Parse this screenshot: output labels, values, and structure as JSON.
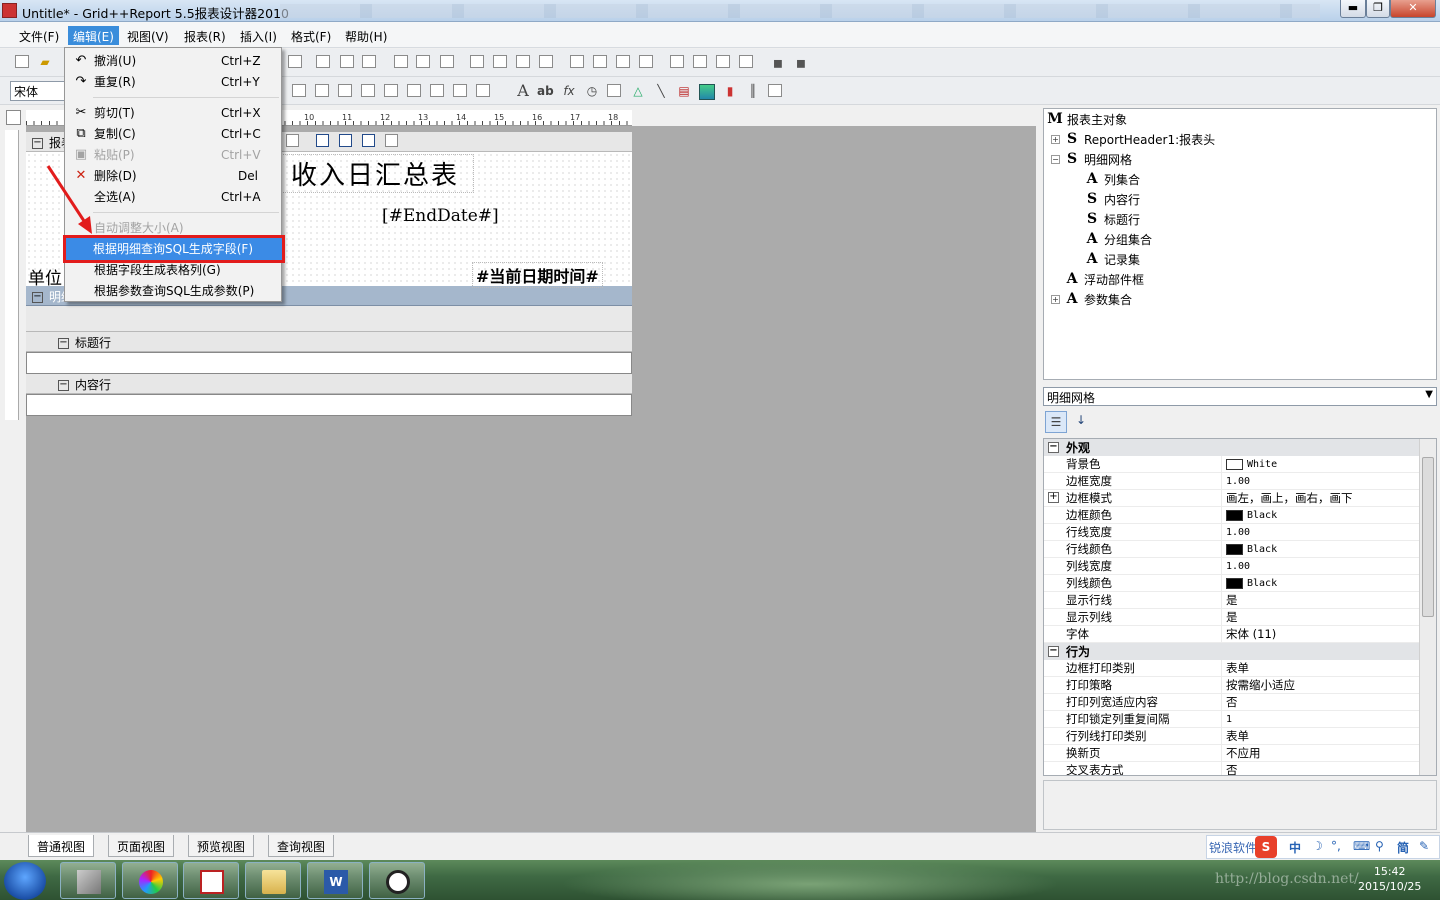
{
  "window": {
    "title": "Untitle* - Grid++Report 5.5报表设计器2010",
    "min": "▬",
    "max": "❐",
    "close": "✕"
  },
  "menubar": [
    {
      "label": "文件(F)"
    },
    {
      "label": "编辑(E)"
    },
    {
      "label": "视图(V)"
    },
    {
      "label": "报表(R)"
    },
    {
      "label": "插入(I)"
    },
    {
      "label": "格式(F)"
    },
    {
      "label": "帮助(H)"
    }
  ],
  "toolbar": {
    "font_name": "宋体"
  },
  "edit_menu": {
    "undo": {
      "label": "撤消(U)",
      "shortcut": "Ctrl+Z"
    },
    "redo": {
      "label": "重复(R)",
      "shortcut": "Ctrl+Y"
    },
    "cut": {
      "label": "剪切(T)",
      "shortcut": "Ctrl+X"
    },
    "copy": {
      "label": "复制(C)",
      "shortcut": "Ctrl+C"
    },
    "paste": {
      "label": "粘贴(P)",
      "shortcut": "Ctrl+V"
    },
    "delete": {
      "label": "删除(D)",
      "shortcut": "Del"
    },
    "select_all": {
      "label": "全选(A)",
      "shortcut": "Ctrl+A"
    },
    "auto_size": {
      "label": "自动调整大小(A)"
    },
    "gen_fields": {
      "label": "根据明细查询SQL生成字段(F)"
    },
    "gen_columns": {
      "label": "根据字段生成表格列(G)"
    },
    "gen_params": {
      "label": "根据参数查询SQL生成参数(P)"
    }
  },
  "ruler": {
    "ticks": [
      "10",
      "11",
      "12",
      "13",
      "14",
      "15",
      "16",
      "17",
      "18"
    ]
  },
  "design": {
    "header_band": "报表",
    "title_text": "收入日汇总表",
    "end_date": "[#EndDate#]",
    "unit_label": "单位",
    "datetime_label": "#当前日期时间#",
    "grid_band": "明细",
    "title_row_band": "标题行",
    "content_row_band": "内容行"
  },
  "tree": [
    {
      "letter": "M",
      "label": "报表主对象",
      "expand": ""
    },
    {
      "letter": "S",
      "label": "ReportHeader1:报表头",
      "expand": "+"
    },
    {
      "letter": "S",
      "label": "明细网格",
      "expand": "−"
    },
    {
      "letter": "A",
      "label": "列集合",
      "expand": ""
    },
    {
      "letter": "S",
      "label": "内容行",
      "expand": ""
    },
    {
      "letter": "S",
      "label": "标题行",
      "expand": ""
    },
    {
      "letter": "A",
      "label": "分组集合",
      "expand": ""
    },
    {
      "letter": "A",
      "label": "记录集",
      "expand": ""
    },
    {
      "letter": "A",
      "label": "浮动部件框",
      "expand": ""
    },
    {
      "letter": "A",
      "label": "参数集合",
      "expand": "+"
    }
  ],
  "object_select": "明细网格",
  "props": {
    "cat_appearance": "外观",
    "cat_behavior": "行为",
    "appearance": [
      {
        "name": "背景色",
        "value": "White",
        "color": "#ffffff"
      },
      {
        "name": "边框宽度",
        "value": "1.00"
      },
      {
        "name": "边框模式",
        "value": "画左，画上，画右，画下",
        "expand": "+"
      },
      {
        "name": "边框颜色",
        "value": "Black",
        "color": "#000000"
      },
      {
        "name": "行线宽度",
        "value": "1.00"
      },
      {
        "name": "行线颜色",
        "value": "Black",
        "color": "#000000"
      },
      {
        "name": "列线宽度",
        "value": "1.00"
      },
      {
        "name": "列线颜色",
        "value": "Black",
        "color": "#000000"
      },
      {
        "name": "显示行线",
        "value": "是"
      },
      {
        "name": "显示列线",
        "value": "是"
      },
      {
        "name": "字体",
        "value": "宋体 (11)"
      }
    ],
    "behavior": [
      {
        "name": "边框打印类别",
        "value": "表单"
      },
      {
        "name": "打印策略",
        "value": "按需缩小适应"
      },
      {
        "name": "打印列宽适应内容",
        "value": "否"
      },
      {
        "name": "打印锁定列重复间隔",
        "value": "1"
      },
      {
        "name": "行列线打印类别",
        "value": "表单"
      },
      {
        "name": "换新页",
        "value": "不应用"
      },
      {
        "name": "交叉表方式",
        "value": "否"
      }
    ]
  },
  "tabs": [
    "普通视图",
    "页面视图",
    "预览视图",
    "查询视图"
  ],
  "ime": {
    "brand": "锐浪软件",
    "zh": "中",
    "simp": "简"
  },
  "clock": {
    "time": "15:42",
    "date": "2015/10/25"
  },
  "watermark": "http://blog.csdn.net/"
}
